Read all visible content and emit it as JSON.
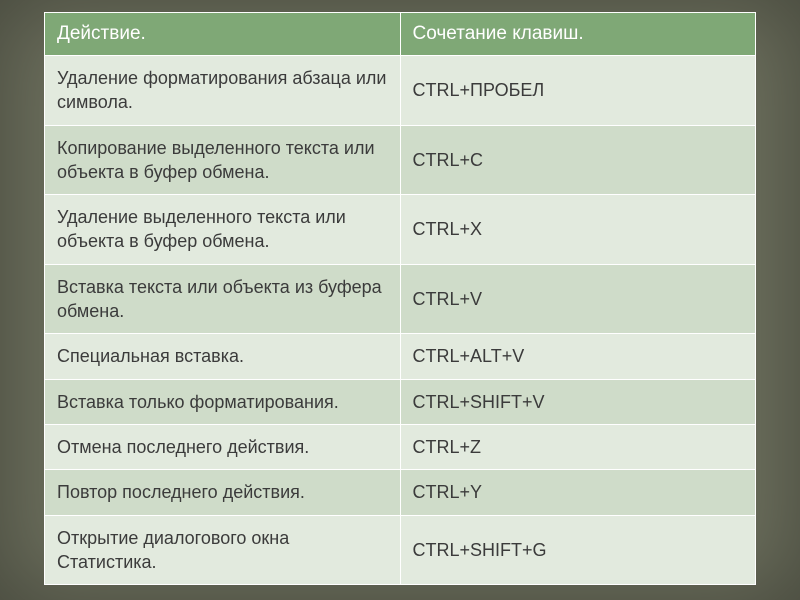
{
  "table": {
    "headers": {
      "action": "Действие.",
      "shortcut": "Сочетание клавиш."
    },
    "rows": [
      {
        "action": "Удаление форматирования абзаца или символа.",
        "shortcut": "CTRL+ПРОБЕЛ"
      },
      {
        "action": "Копирование выделенного текста или объекта в буфер обмена.",
        "shortcut": "CTRL+C"
      },
      {
        "action": "Удаление выделенного текста или объекта в буфер обмена.",
        "shortcut": "CTRL+X"
      },
      {
        "action": "Вставка текста или объекта из буфера обмена.",
        "shortcut": "CTRL+V"
      },
      {
        "action": "Специальная вставка.",
        "shortcut": "CTRL+ALT+V"
      },
      {
        "action": "Вставка только форматирования.",
        "shortcut": "CTRL+SHIFT+V"
      },
      {
        "action": "Отмена последнего действия.",
        "shortcut": "CTRL+Z"
      },
      {
        "action": "Повтор последнего действия.",
        "shortcut": "CTRL+Y"
      },
      {
        "action": "Открытие диалогового окна Статистика.",
        "shortcut": "CTRL+SHIFT+G"
      }
    ]
  }
}
